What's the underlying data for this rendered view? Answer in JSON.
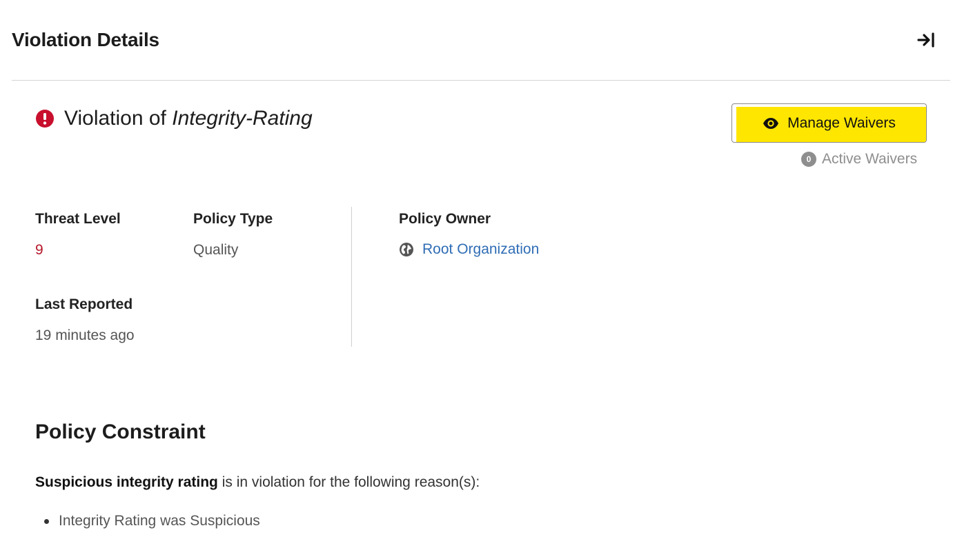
{
  "panel": {
    "title": "Violation Details",
    "collapse_icon": "arrow-right-to-bar-icon"
  },
  "violation": {
    "prefix": "Violation of",
    "policy_name": "Integrity-Rating",
    "status_icon": "exclamation-circle-icon",
    "status_color": "#c8102e"
  },
  "waivers": {
    "manage_label": "Manage Waivers",
    "manage_icon": "eye-icon",
    "highlight_color": "#ffe600",
    "active_count": "0",
    "active_label": "Active Waivers"
  },
  "details": {
    "threat_level_label": "Threat Level",
    "threat_level_value": "9",
    "threat_color": "#b5172b",
    "policy_type_label": "Policy Type",
    "policy_type_value": "Quality",
    "last_reported_label": "Last Reported",
    "last_reported_value": "19 minutes ago",
    "policy_owner_label": "Policy Owner",
    "policy_owner_icon": "globe-icon",
    "policy_owner_value": "Root Organization",
    "link_color": "#2f6db5"
  },
  "constraint": {
    "title": "Policy Constraint",
    "name": "Suspicious integrity rating",
    "description": "is in violation for the following reason(s):",
    "reasons": [
      "Integrity Rating was Suspicious"
    ]
  }
}
